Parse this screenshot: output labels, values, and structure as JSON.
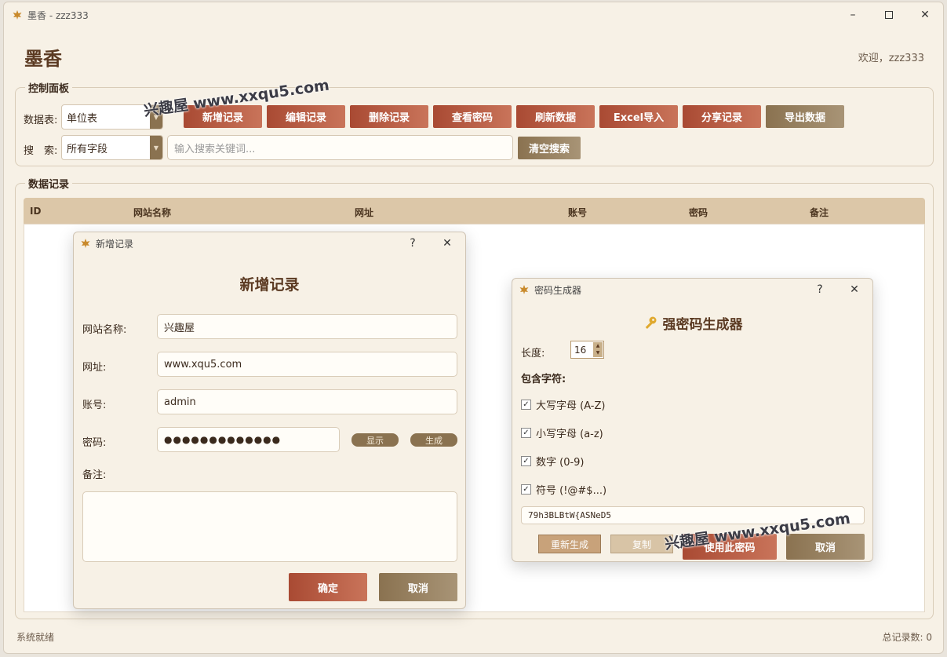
{
  "window": {
    "title": "墨香 - zzz333",
    "app_title": "墨香",
    "welcome": "欢迎，zzz333"
  },
  "control_panel": {
    "title": "控制面板",
    "table_label": "数据表:",
    "table_value": "单位表",
    "search_label": "搜　索:",
    "search_field_value": "所有字段",
    "search_placeholder": "输入搜索关键词...",
    "clear_search": "清空搜索",
    "buttons": [
      "新增记录",
      "编辑记录",
      "删除记录",
      "查看密码",
      "刷新数据",
      "Excel导入",
      "分享记录",
      "导出数据"
    ]
  },
  "records": {
    "title": "数据记录",
    "columns": [
      "ID",
      "网站名称",
      "网址",
      "账号",
      "密码",
      "备注"
    ],
    "rows": []
  },
  "status": {
    "left": "系统就绪",
    "right": "总记录数: 0"
  },
  "add_dialog": {
    "window_title": "新增记录",
    "heading": "新增记录",
    "help": "?",
    "labels": {
      "site_name": "网站名称:",
      "url": "网址:",
      "account": "账号:",
      "password": "密码:",
      "note": "备注:"
    },
    "values": {
      "site_name": "兴趣屋",
      "url": "www.xqu5.com",
      "account": "admin",
      "password": "●●●●●●●●●●●●●",
      "note": ""
    },
    "show_button": "显示",
    "generate_button": "生成",
    "ok_button": "确定",
    "cancel_button": "取消"
  },
  "pwd_dialog": {
    "window_title": "密码生成器",
    "help": "?",
    "heading": "强密码生成器",
    "length_label": "长度:",
    "length_value": "16",
    "include_label": "包含字符:",
    "options": [
      {
        "label": "大写字母 (A-Z)",
        "checked": true
      },
      {
        "label": "小写字母 (a-z)",
        "checked": true
      },
      {
        "label": "数字 (0-9)",
        "checked": true
      },
      {
        "label": "符号 (!@#$...)",
        "checked": true
      }
    ],
    "generated": "79h3BLBtW{ASNeD5",
    "regenerate_button": "重新生成",
    "copy_button": "复制",
    "use_button": "使用此密码",
    "cancel_button": "取消"
  },
  "watermark": "兴趣屋 www.xxqu5.com",
  "colors": {
    "accent_red": "#a94a33",
    "accent_tan": "#8a7250",
    "background": "#f7f1e6",
    "header_bg": "#dcc7a8"
  }
}
